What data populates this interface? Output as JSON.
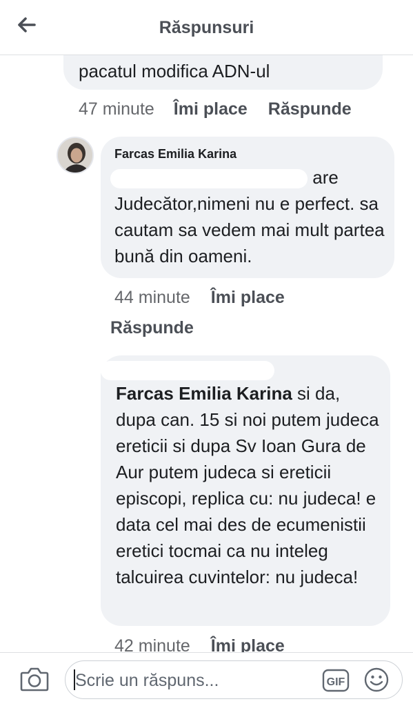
{
  "header": {
    "title": "Răspunsuri",
    "back_icon": "arrow-left-icon"
  },
  "comments": [
    {
      "text": "pacatul modifica ADN-ul",
      "time": "47 minute",
      "like_label": "Îmi place",
      "reply_label": "Răspunde"
    },
    {
      "author": "Farcas Emilia Karina",
      "line1_suffix": "are",
      "text_rest": "Judecător,nimeni nu e perfect. sa cautam sa vedem mai mult partea bună din oameni.",
      "time": "44 minute",
      "like_label": "Îmi place",
      "reply_label": "Răspunde"
    },
    {
      "mention": "Farcas Emilia Karina",
      "text": " si da, dupa can. 15 si noi putem judeca ereticii si dupa Sv Ioan Gura de Aur putem judeca si ereticii episcopi, replica cu: nu judeca! e data cel mai des de ecumenistii eretici tocmai ca nu inteleg talcuirea cuvintelor: nu judeca!",
      "time": "42 minute",
      "like_label": "Îmi place"
    }
  ],
  "composer": {
    "placeholder": "Scrie un răspuns...",
    "camera_icon": "camera-icon",
    "gif_icon": "gif-icon",
    "emoji_icon": "smiley-icon"
  }
}
